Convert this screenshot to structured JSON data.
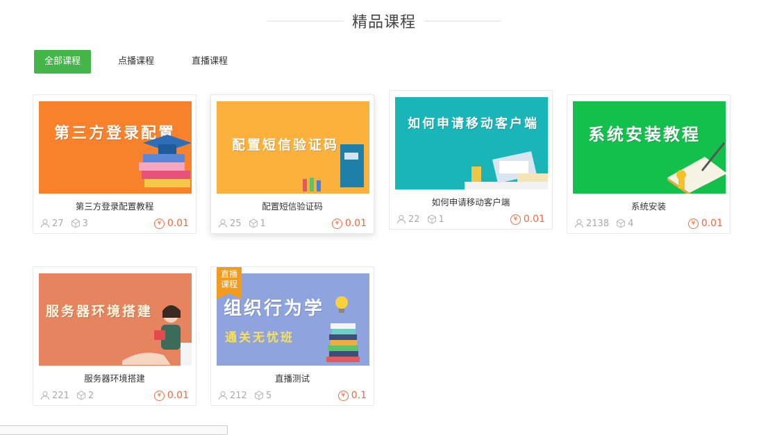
{
  "header": {
    "title": "精品课程"
  },
  "tabs": [
    {
      "label": "全部课程",
      "active": true
    },
    {
      "label": "点播课程",
      "active": false
    },
    {
      "label": "直播课程",
      "active": false
    }
  ],
  "courses": [
    {
      "name": "第三方登录配置教程",
      "thumb_text": "第三方登录配置",
      "thumb_color": "#f7822b",
      "students": "27",
      "lessons": "3",
      "price": "0.01",
      "live": false
    },
    {
      "name": "配置短信验证码",
      "thumb_text": "配置短信验证码",
      "thumb_color": "#fbb13b",
      "students": "25",
      "lessons": "1",
      "price": "0.01",
      "live": false
    },
    {
      "name": "如何申请移动客户端",
      "thumb_text": "如何申请移动客户端",
      "thumb_color": "#19b5b8",
      "students": "22",
      "lessons": "1",
      "price": "0.01",
      "live": false
    },
    {
      "name": "系统安装",
      "thumb_text": "系统安装教程",
      "thumb_color": "#14c04c",
      "students": "2138",
      "lessons": "4",
      "price": "0.01",
      "live": false
    },
    {
      "name": "服务器环境搭建",
      "thumb_text": "服务器环境搭建",
      "thumb_color": "#e5845e",
      "students": "221",
      "lessons": "2",
      "price": "0.01",
      "live": false
    },
    {
      "name": "直播测试",
      "thumb_text": "组织行为学",
      "thumb_sub": "通关无忧班",
      "thumb_color": "#8fa4df",
      "students": "212",
      "lessons": "5",
      "price": "0.1",
      "live": true,
      "badge_line1": "直播",
      "badge_line2": "课程"
    }
  ],
  "currency_symbol": "¥",
  "colors": {
    "accent": "#44b549",
    "price": "#f0693c",
    "badge": "#f29b1f"
  },
  "icons": {
    "students": "user-icon",
    "lessons": "cube-icon",
    "price": "yen-icon"
  }
}
